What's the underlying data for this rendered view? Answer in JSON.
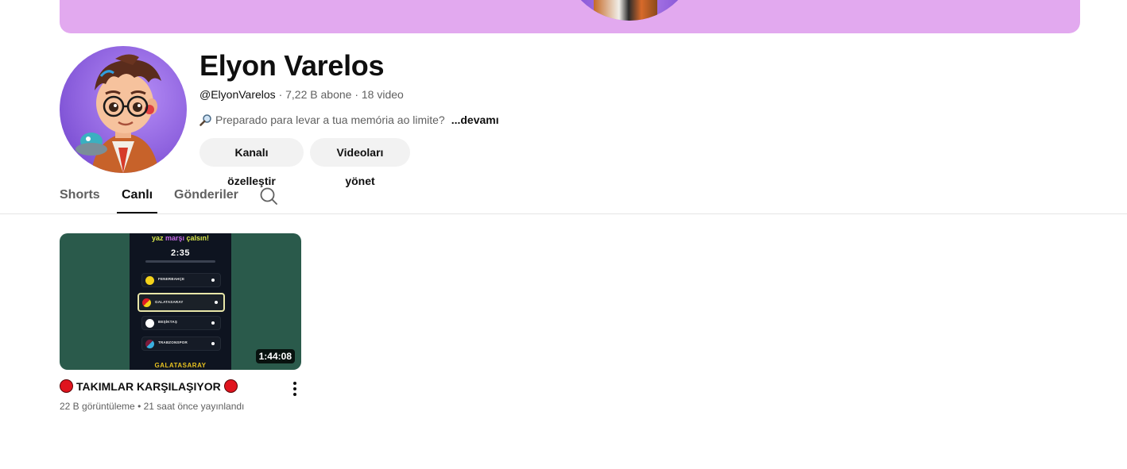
{
  "channel": {
    "name": "Elyon Varelos",
    "handle": "@ElyonVarelos",
    "subscribers": "7,22 B abone",
    "videos": "18 video",
    "separator": "·",
    "description": "Preparado para levar a tua memória ao limite?",
    "description_more": "...devamı"
  },
  "actions": {
    "customize_label": "Kanalı özelleştir",
    "manage_label": "Videoları yönet"
  },
  "tabs": [
    {
      "label": "Shorts",
      "active": false
    },
    {
      "label": "Canlı",
      "active": true
    },
    {
      "label": "Gönderiler",
      "active": false
    }
  ],
  "video": {
    "title": "TAKIMLAR KARŞILAŞIYOR",
    "duration": "1:44:08",
    "views": "22 B görüntüleme",
    "meta_separator": "•",
    "published": "21 saat önce yayınlandı",
    "thumbnail": {
      "headline_a": "yaz",
      "headline_b": "marşı",
      "headline_c": "çalsın!",
      "timer": "2:35",
      "teams": [
        "FENERBAHÇE",
        "GALATASARAY",
        "BEŞİKTAŞ",
        "TRABZONSPOR"
      ],
      "selected_team": "GALATASARAY",
      "footer": "GALATASARAY"
    }
  },
  "colors": {
    "banner": "#e2a9ef",
    "accent_text": "#0f0f0f",
    "secondary_text": "#606060",
    "button_bg": "#f2f2f2",
    "live_red": "#e0141e"
  },
  "icons": {
    "description": "magnifier-icon",
    "tab_search": "search-icon",
    "video_menu": "more-vert-icon",
    "title_prefix": "red-circle-icon"
  }
}
